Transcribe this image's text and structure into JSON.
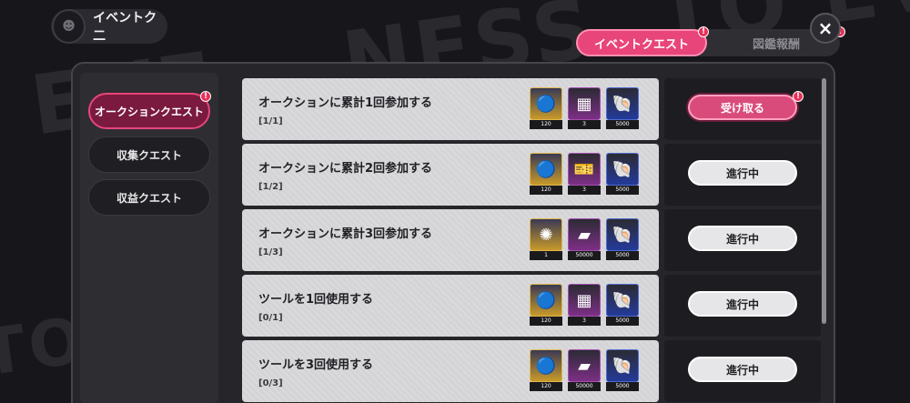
{
  "header": {
    "title": "イベントク二"
  },
  "tabs": [
    {
      "label": "イベントクエスト",
      "badge": "!"
    },
    {
      "label": "図鑑報酬",
      "badge": "!"
    }
  ],
  "close_label": "×",
  "sidebar": {
    "items": [
      {
        "label": "オークションクエスト",
        "badge": "!"
      },
      {
        "label": "収集クエスト"
      },
      {
        "label": "収益クエスト"
      }
    ]
  },
  "quests": [
    {
      "title": "オークションに累計1回参加する",
      "progress": "[1/1]",
      "action": "受け取る",
      "action_badge": "!",
      "rewards": [
        {
          "icon": "blue-orb",
          "count": "120"
        },
        {
          "icon": "black-box",
          "count": "3"
        },
        {
          "icon": "shell",
          "count": "5000"
        }
      ]
    },
    {
      "title": "オークションに累計2回参加する",
      "progress": "[1/2]",
      "action": "進行中",
      "rewards": [
        {
          "icon": "blue-orb",
          "count": "120"
        },
        {
          "icon": "ticket",
          "count": "3"
        },
        {
          "icon": "shell",
          "count": "5000"
        }
      ]
    },
    {
      "title": "オークションに累計3回参加する",
      "progress": "[1/3]",
      "action": "進行中",
      "rewards": [
        {
          "icon": "gold-wreath",
          "count": "1"
        },
        {
          "icon": "black-card",
          "count": "50000"
        },
        {
          "icon": "shell",
          "count": "5000"
        }
      ]
    },
    {
      "title": "ツールを1回使用する",
      "progress": "[0/1]",
      "action": "進行中",
      "rewards": [
        {
          "icon": "blue-orb",
          "count": "120"
        },
        {
          "icon": "black-box",
          "count": "3"
        },
        {
          "icon": "shell",
          "count": "5000"
        }
      ]
    },
    {
      "title": "ツールを3回使用する",
      "progress": "[0/3]",
      "action": "進行中",
      "rewards": [
        {
          "icon": "blue-orb",
          "count": "120"
        },
        {
          "icon": "black-card",
          "count": "50000"
        },
        {
          "icon": "shell",
          "count": "5000"
        }
      ]
    }
  ]
}
